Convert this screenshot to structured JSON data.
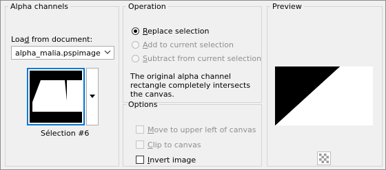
{
  "alpha_channels": {
    "legend": "Alpha channels",
    "load_from_label": "Load from document:",
    "load_from_accel": "d",
    "document_value": "alpha_malia.pspimage",
    "selection_name": "Sélection #6"
  },
  "operation": {
    "legend": "Operation",
    "options": [
      {
        "label": "Replace selection",
        "accel": "R",
        "checked": true,
        "enabled": true
      },
      {
        "label": "Add to current selection",
        "accel": "A",
        "checked": false,
        "enabled": false
      },
      {
        "label": "Subtract from current selection",
        "accel": "S",
        "checked": false,
        "enabled": false
      }
    ],
    "description": "The original alpha channel rectangle completely intersects the canvas."
  },
  "options": {
    "legend": "Options",
    "items": [
      {
        "label": "Move to upper left of canvas",
        "accel": "M",
        "checked": false,
        "enabled": false
      },
      {
        "label": "Clip to canvas",
        "accel": "C",
        "checked": false,
        "enabled": false
      },
      {
        "label": "Invert image",
        "accel": "I",
        "checked": false,
        "enabled": true
      }
    ]
  },
  "preview": {
    "legend": "Preview",
    "transparency_button_icon": "checkerboard-icon"
  },
  "colors": {
    "focus_border": "#0078d7",
    "mask_black": "#000000",
    "mask_white": "#ffffff",
    "disabled_text": "#8f8f8f"
  }
}
